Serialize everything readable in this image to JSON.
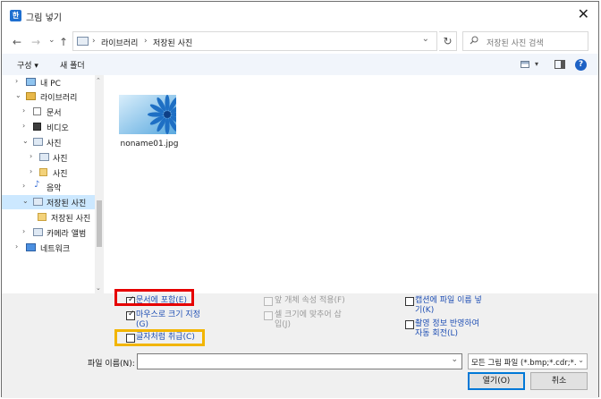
{
  "window": {
    "title": "그림 넣기",
    "app_icon_glyph": "한",
    "close_glyph": "✕"
  },
  "nav": {
    "back_glyph": "←",
    "forward_glyph": "→",
    "recent_glyph": "⌄",
    "up_glyph": "↑",
    "refresh_glyph": "↻"
  },
  "address": {
    "sep1": "›",
    "crumb1": "라이브러리",
    "sep2": "›",
    "crumb2": "저장된 사진",
    "dropdown_glyph": "⌄"
  },
  "search": {
    "placeholder": "저장된 사진 검색"
  },
  "toolbar": {
    "organize": "구성 ▾",
    "new_folder": "새 폴더",
    "view_dd": "▾",
    "help": "?"
  },
  "tree": {
    "items": [
      {
        "label": "내 PC",
        "twist": "›",
        "icon": "pc-icon"
      },
      {
        "label": "라이브러리",
        "twist": "⌄",
        "icon": "library-icon"
      },
      {
        "label": "문서",
        "twist": "›",
        "icon": "document-icon"
      },
      {
        "label": "비디오",
        "twist": "›",
        "icon": "video-icon"
      },
      {
        "label": "사진",
        "twist": "⌄",
        "icon": "pictures-icon"
      },
      {
        "label": "사진",
        "twist": "›",
        "icon": "pictures-icon"
      },
      {
        "label": "사진",
        "twist": "›",
        "icon": "folder-icon"
      },
      {
        "label": "음악",
        "twist": "›",
        "icon": "music-icon"
      },
      {
        "label": "저장된 사진",
        "twist": "⌄",
        "icon": "pictures-icon"
      },
      {
        "label": "저장된 사진",
        "twist": "",
        "icon": "folder-icon"
      },
      {
        "label": "카메라 앨범",
        "twist": "›",
        "icon": "pictures-icon"
      },
      {
        "label": "네트워크",
        "twist": "›",
        "icon": "network-icon"
      }
    ],
    "scroll_up": "⌃",
    "scroll_down": "⌄"
  },
  "files": [
    {
      "name": "noname01.jpg"
    }
  ],
  "options": {
    "include_in_doc": "문서에 포함(E)",
    "set_by_mouse": "마우스로 크기 지정",
    "set_by_mouse_key": "(G)",
    "treat_as_char": "글자처럼 취급(C)",
    "apply_cell_props": "앞 개체 속성 적용(F)",
    "fit_cell_1": "셀 크기에 맞추어 삽",
    "fit_cell_2": "입(J)",
    "caption_1": "캡션에 파일 이름 넣",
    "caption_2": "기(K)",
    "rotate_1": "촬영 정보 반영하여",
    "rotate_2": "자동 회전(L)"
  },
  "checks": {
    "include_in_doc": true,
    "set_by_mouse": true,
    "treat_as_char": false,
    "apply_cell_props": false,
    "fit_cell": false,
    "caption": false,
    "rotate": false
  },
  "bottom": {
    "filename_label": "파일 이름(N):",
    "filename_value": "",
    "dropdown_glyph": "⌄",
    "filter": "모든 그림 파일 (*.bmp;*.cdr;*.c",
    "open": "열기(O)",
    "cancel": "취소"
  },
  "colors": {
    "accent": "#0078d7",
    "selection": "#cce8ff",
    "highlight_red": "#e60000",
    "highlight_yellow": "#f2b500",
    "link_blue": "#1f4fb4"
  }
}
